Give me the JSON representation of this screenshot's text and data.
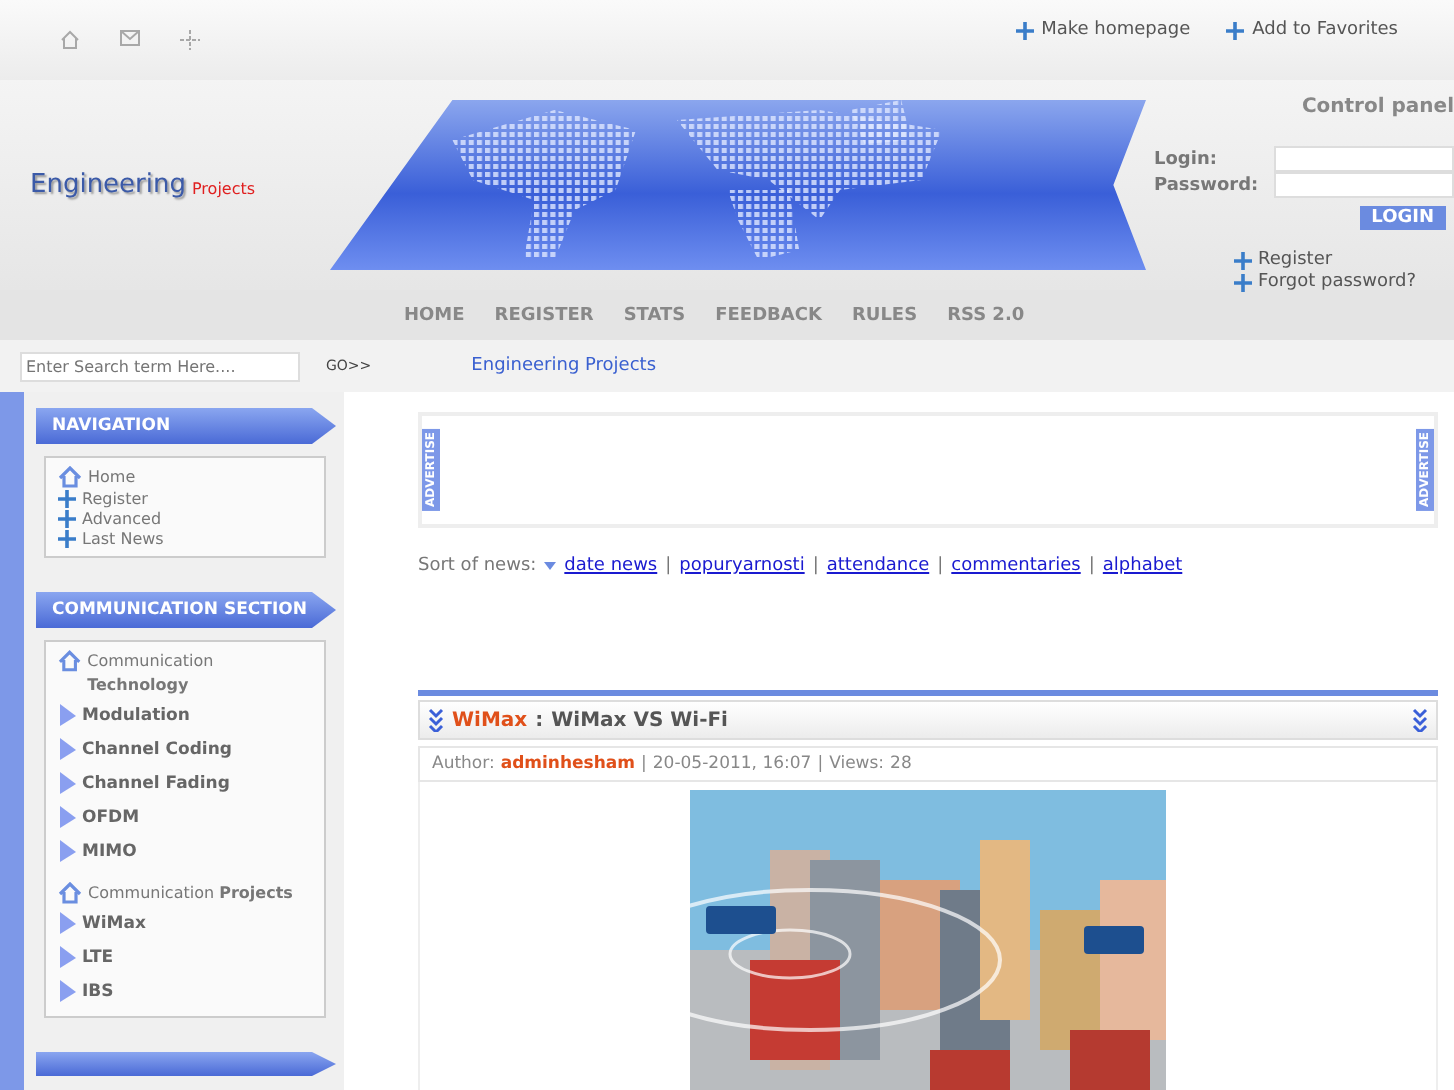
{
  "top_links": [
    "Make homepage",
    "Add to Favorites"
  ],
  "logo": {
    "main": "Engineering",
    "sub": "Projects"
  },
  "control_panel": {
    "title": "Control panel",
    "login_label": "Login:",
    "password_label": "Password:",
    "button": "LOGIN",
    "links": [
      "Register",
      "Forgot password?"
    ]
  },
  "menu": [
    "HOME",
    "REGISTER",
    "STATS",
    "FEEDBACK",
    "RULES",
    "RSS 2.0"
  ],
  "search": {
    "placeholder": "Enter Search term Here....",
    "go": "GO>>"
  },
  "breadcrumb": "Engineering Projects",
  "sidebar": [
    {
      "title": "NAVIGATION",
      "items": [
        {
          "kind": "home",
          "label": "Home"
        },
        {
          "kind": "link",
          "label": "Register"
        },
        {
          "kind": "link",
          "label": "Advanced"
        },
        {
          "kind": "link",
          "label": "Last News"
        }
      ]
    },
    {
      "title": "COMMUNICATION SECTION",
      "items": [
        {
          "kind": "group",
          "label": "Communication **Technology**"
        },
        {
          "kind": "arrow",
          "label": "Modulation"
        },
        {
          "kind": "arrow",
          "label": "Channel Coding"
        },
        {
          "kind": "arrow",
          "label": "Channel Fading"
        },
        {
          "kind": "arrow",
          "label": "OFDM"
        },
        {
          "kind": "arrow",
          "label": "MIMO"
        },
        {
          "kind": "group",
          "label": "Communication **Projects**"
        },
        {
          "kind": "arrow",
          "label": "WiMax"
        },
        {
          "kind": "arrow",
          "label": "LTE"
        },
        {
          "kind": "arrow",
          "label": "IBS"
        }
      ]
    }
  ],
  "ad_labels": [
    "ADVERTISE",
    "ADVERTISE"
  ],
  "sort": {
    "label": "Sort of news:",
    "options": [
      "date news",
      "popuryarnosti",
      "attendance",
      "commentaries",
      "alphabet"
    ],
    "separators": [
      "|",
      "|",
      "|",
      "|"
    ]
  },
  "article": {
    "category": "WiMax",
    "colon": ":",
    "title": "WiMax VS Wi-Fi",
    "author_label": "Author:",
    "author": "adminhesham",
    "date": "20-05-2011, 16:07",
    "views_label": "Views:",
    "views": "28",
    "separators": [
      "|",
      "|"
    ]
  }
}
